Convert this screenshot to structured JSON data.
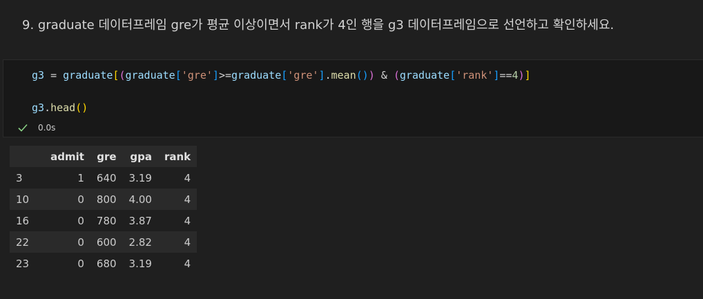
{
  "markdown": {
    "text": "9. graduate 데이터프레임 gre가 평균 이상이면서 rank가 4인 행을 g3 데이터프레임으로 선언하고 확인하세요."
  },
  "code": {
    "line1": {
      "var": "g3",
      "assign": " = ",
      "df1": "graduate",
      "br_open1": "[",
      "paren_open1": "(",
      "df2": "graduate",
      "br_open2": "[",
      "str1": "'gre'",
      "br_close2": "]",
      "op_ge": ">=",
      "df3": "graduate",
      "br_open3": "[",
      "str2": "'gre'",
      "br_close3": "]",
      "dot": ".",
      "func": "mean",
      "call": "()",
      "paren_close1": ")",
      "amp": " & ",
      "paren_open2": "(",
      "df4": "graduate",
      "br_open4": "[",
      "str3": "'rank'",
      "br_close4": "]",
      "op_eq": "==",
      "num": "4",
      "paren_close2": ")",
      "br_close1": "]"
    },
    "line2": {
      "var": "g3",
      "dot": ".",
      "func": "head",
      "call": "()"
    }
  },
  "status": {
    "icon": "check-icon",
    "time": "0.0s",
    "color": "#89d185"
  },
  "output": {
    "columns": [
      "",
      "admit",
      "gre",
      "gpa",
      "rank"
    ],
    "rows": [
      {
        "index": "3",
        "admit": "1",
        "gre": "640",
        "gpa": "3.19",
        "rank": "4"
      },
      {
        "index": "10",
        "admit": "0",
        "gre": "800",
        "gpa": "4.00",
        "rank": "4"
      },
      {
        "index": "16",
        "admit": "0",
        "gre": "780",
        "gpa": "3.87",
        "rank": "4"
      },
      {
        "index": "22",
        "admit": "0",
        "gre": "600",
        "gpa": "2.82",
        "rank": "4"
      },
      {
        "index": "23",
        "admit": "0",
        "gre": "680",
        "gpa": "3.19",
        "rank": "4"
      }
    ]
  }
}
